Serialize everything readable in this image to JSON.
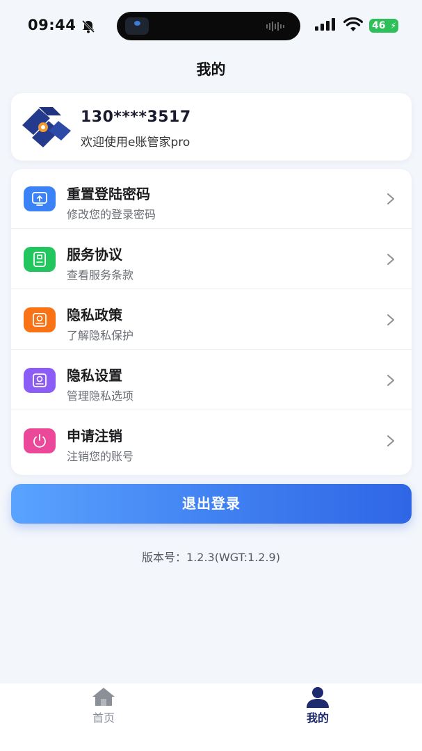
{
  "status_bar": {
    "time": "09:44",
    "battery": "46"
  },
  "header": {
    "title": "我的"
  },
  "profile": {
    "phone": "130****3517",
    "welcome": "欢迎使用e账管家pro"
  },
  "menu": {
    "items": [
      {
        "title": "重置登陆密码",
        "subtitle": "修改您的登录密码",
        "icon": "screen-upload-icon",
        "color": "#3b82f6"
      },
      {
        "title": "服务协议",
        "subtitle": "查看服务条款",
        "icon": "document-icon",
        "color": "#22c55e"
      },
      {
        "title": "隐私政策",
        "subtitle": "了解隐私保护",
        "icon": "privacy-icon",
        "color": "#f97316"
      },
      {
        "title": "隐私设置",
        "subtitle": "管理隐私选项",
        "icon": "settings-icon",
        "color": "#8b5cf6"
      },
      {
        "title": "申请注销",
        "subtitle": "注销您的账号",
        "icon": "power-icon",
        "color": "#ec4899"
      }
    ]
  },
  "logout": {
    "label": "退出登录"
  },
  "version": {
    "text": "版本号：1.2.3(WGT:1.2.9)"
  },
  "tab_bar": {
    "tabs": [
      {
        "label": "首页",
        "icon": "home-icon"
      },
      {
        "label": "我的",
        "icon": "user-icon",
        "active": true
      }
    ],
    "active_color": "#1e2a6e",
    "inactive_color": "#8a8f98"
  }
}
